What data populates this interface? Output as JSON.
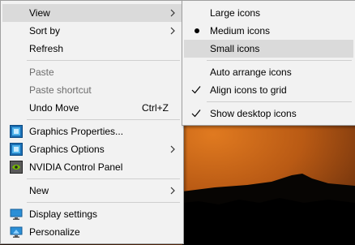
{
  "context_menu": {
    "items": [
      {
        "label": "View"
      },
      {
        "label": "Sort by"
      },
      {
        "label": "Refresh"
      },
      {
        "label": "Paste"
      },
      {
        "label": "Paste shortcut"
      },
      {
        "label": "Undo Move",
        "shortcut": "Ctrl+Z"
      },
      {
        "label": "Graphics Properties...",
        "icon": "intel-graphics-icon"
      },
      {
        "label": "Graphics Options",
        "icon": "intel-graphics-icon"
      },
      {
        "label": "NVIDIA Control Panel",
        "icon": "nvidia-icon"
      },
      {
        "label": "New"
      },
      {
        "label": "Display settings",
        "icon": "display-icon"
      },
      {
        "label": "Personalize",
        "icon": "personalize-icon"
      }
    ]
  },
  "view_submenu": {
    "items": [
      {
        "label": "Large icons"
      },
      {
        "label": "Medium icons",
        "selected": true
      },
      {
        "label": "Small icons"
      },
      {
        "label": "Auto arrange icons"
      },
      {
        "label": "Align icons to grid",
        "checked": true
      },
      {
        "label": "Show desktop icons",
        "checked": true
      }
    ]
  },
  "colors": {
    "menu_bg": "#f2f2f2",
    "highlight": "#dadada",
    "disabled_text": "#6d6d6d"
  }
}
